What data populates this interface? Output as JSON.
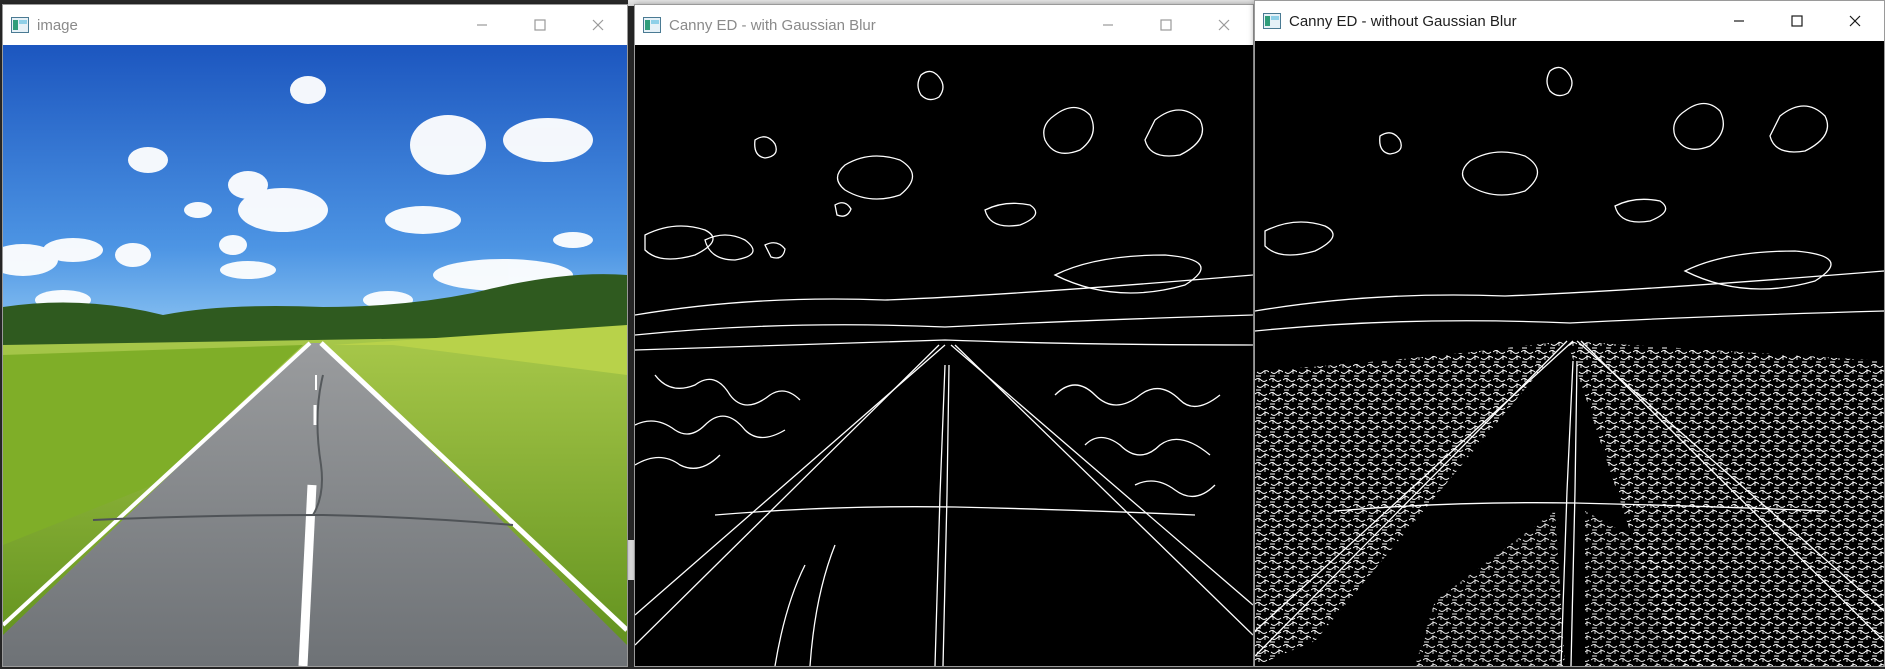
{
  "windows": [
    {
      "title": "image",
      "state": "inactive"
    },
    {
      "title": "Canny ED - with Gaussian Blur",
      "state": "inactive"
    },
    {
      "title": "Canny ED - without Gaussian Blur",
      "state": "active"
    }
  ],
  "controls": {
    "minimize_icon": "minimize-icon",
    "maximize_icon": "maximize-icon",
    "close_icon": "close-icon"
  },
  "colors": {
    "sky_top": "#1f5fc4",
    "sky_bottom": "#6fb3ee",
    "field": "#8fbf2a",
    "road": "#7a7d80",
    "edge_bg": "#000000",
    "edge_line": "#ffffff"
  }
}
